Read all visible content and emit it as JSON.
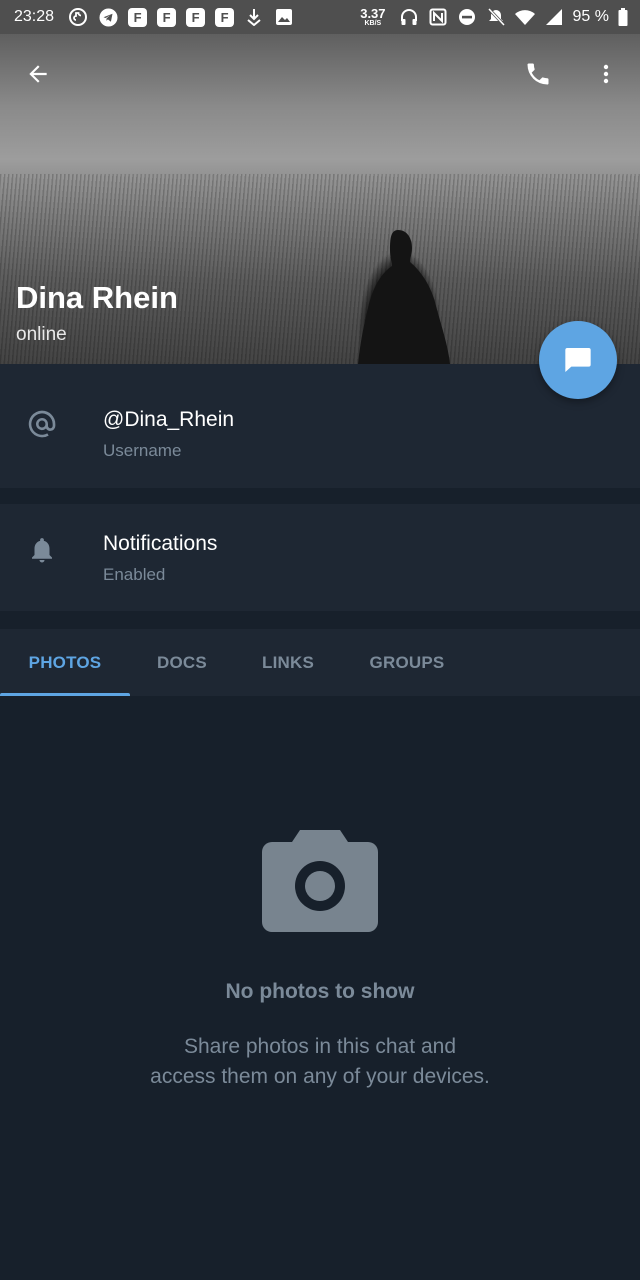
{
  "status_bar": {
    "time": "23:28",
    "speed_value": "3.37",
    "speed_unit": "KB/S",
    "battery": "95 %",
    "left_icons": [
      "tiktok-icon",
      "telegram-icon",
      "f-app-icon",
      "f-app-icon",
      "f-app-icon",
      "f-app-icon",
      "download-icon",
      "image-icon"
    ],
    "f_letter": "F",
    "right_icons": [
      "headphones-icon",
      "nfc-icon",
      "dnd-icon",
      "mute-icon",
      "wifi-icon",
      "signal-icon",
      "battery-icon"
    ]
  },
  "header": {
    "name": "Dina Rhein",
    "status": "online",
    "actions": [
      "back-arrow-icon",
      "phone-icon",
      "more-vert-icon"
    ]
  },
  "username_row": {
    "value": "@Dina_Rhein",
    "label": "Username",
    "icon": "at-sign-icon"
  },
  "notifications_row": {
    "title": "Notifications",
    "value": "Enabled",
    "icon": "bell-icon"
  },
  "tabs": [
    {
      "label": "PHOTOS",
      "active": true
    },
    {
      "label": "DOCS",
      "active": false
    },
    {
      "label": "LINKS",
      "active": false
    },
    {
      "label": "GROUPS",
      "active": false
    }
  ],
  "empty_state": {
    "icon": "camera-icon",
    "title": "No photos to show",
    "line1": "Share photos in this chat and",
    "line2": "access them on any of your devices."
  },
  "colors": {
    "accent": "#5ea5e3",
    "background": "#17202b",
    "panel": "#1e2733",
    "muted_text": "#7b8a99"
  }
}
